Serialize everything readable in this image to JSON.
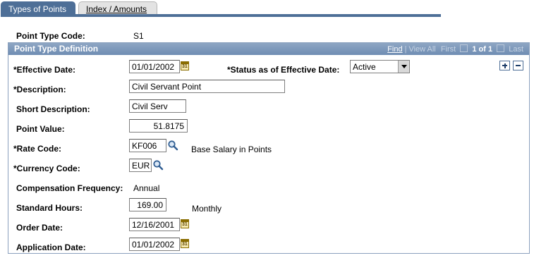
{
  "tabs": [
    {
      "label": "Types of Points",
      "active": true
    },
    {
      "label": "Index / Amounts",
      "active": false
    }
  ],
  "header_fields": {
    "point_type_code_label": "Point Type Code:",
    "point_type_code_value": "S1"
  },
  "panel": {
    "title": "Point Type Definition",
    "nav": {
      "find": "Find",
      "view_all": "View All",
      "first": "First",
      "counter": "1 of 1",
      "last": "Last"
    }
  },
  "form": {
    "effective_date": {
      "label": "*Effective Date:",
      "value": "01/01/2002"
    },
    "status": {
      "label": "*Status as of Effective Date:",
      "value": "Active"
    },
    "description": {
      "label": "*Description:",
      "value": "Civil Servant Point"
    },
    "short_description": {
      "label": "Short Description:",
      "value": "Civil Serv"
    },
    "point_value": {
      "label": "Point Value:",
      "value": "51.8175"
    },
    "rate_code": {
      "label": "*Rate Code:",
      "value": "KF006",
      "description": "Base Salary in Points"
    },
    "currency_code": {
      "label": "*Currency Code:",
      "value": "EUR"
    },
    "compensation_frequency": {
      "label": "Compensation Frequency:",
      "value": "Annual"
    },
    "standard_hours": {
      "label": "Standard Hours:",
      "value": "169.00",
      "unit": "Monthly"
    },
    "order_date": {
      "label": "Order Date:",
      "value": "12/16/2001"
    },
    "application_date": {
      "label": "Application Date:",
      "value": "01/01/2002"
    }
  },
  "icons": {
    "calendar": "calendar-icon",
    "lookup": "magnifier-icon",
    "add_row": "plus-icon",
    "delete_row": "minus-icon"
  },
  "colors": {
    "tab_active": "#4e6f97",
    "panel_header": "#7a96b8",
    "border": "#8aa0bd"
  }
}
